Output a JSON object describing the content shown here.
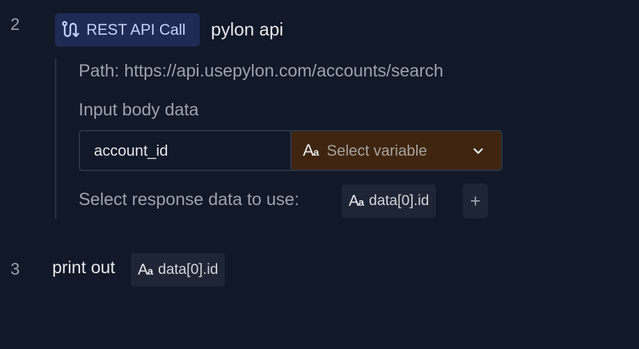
{
  "steps": [
    {
      "number": "2"
    },
    {
      "number": "3"
    }
  ],
  "rest_step": {
    "badge_label": "REST API Call",
    "badge_icon": "route-icon",
    "title": "pylon api",
    "path_label": "Path:",
    "path_value": "https://api.usepylon.com/accounts/search",
    "body_label": "Input body data",
    "body_key_value": "account_id",
    "variable_placeholder": "Select variable",
    "response_label": "Select response data to use:",
    "response_chip_label": "data[0].id",
    "add_button_label": "+"
  },
  "print_step": {
    "text": "print out",
    "chip_label": "data[0].id"
  },
  "icons": {
    "type": "text-type-icon",
    "chevron": "chevron-down-icon"
  },
  "colors": {
    "background": "#111827",
    "badge_bg": "#1f2a55",
    "badge_text": "#c7d2fe",
    "select_bg": "#3f250f",
    "chip_bg": "#1e2635"
  }
}
